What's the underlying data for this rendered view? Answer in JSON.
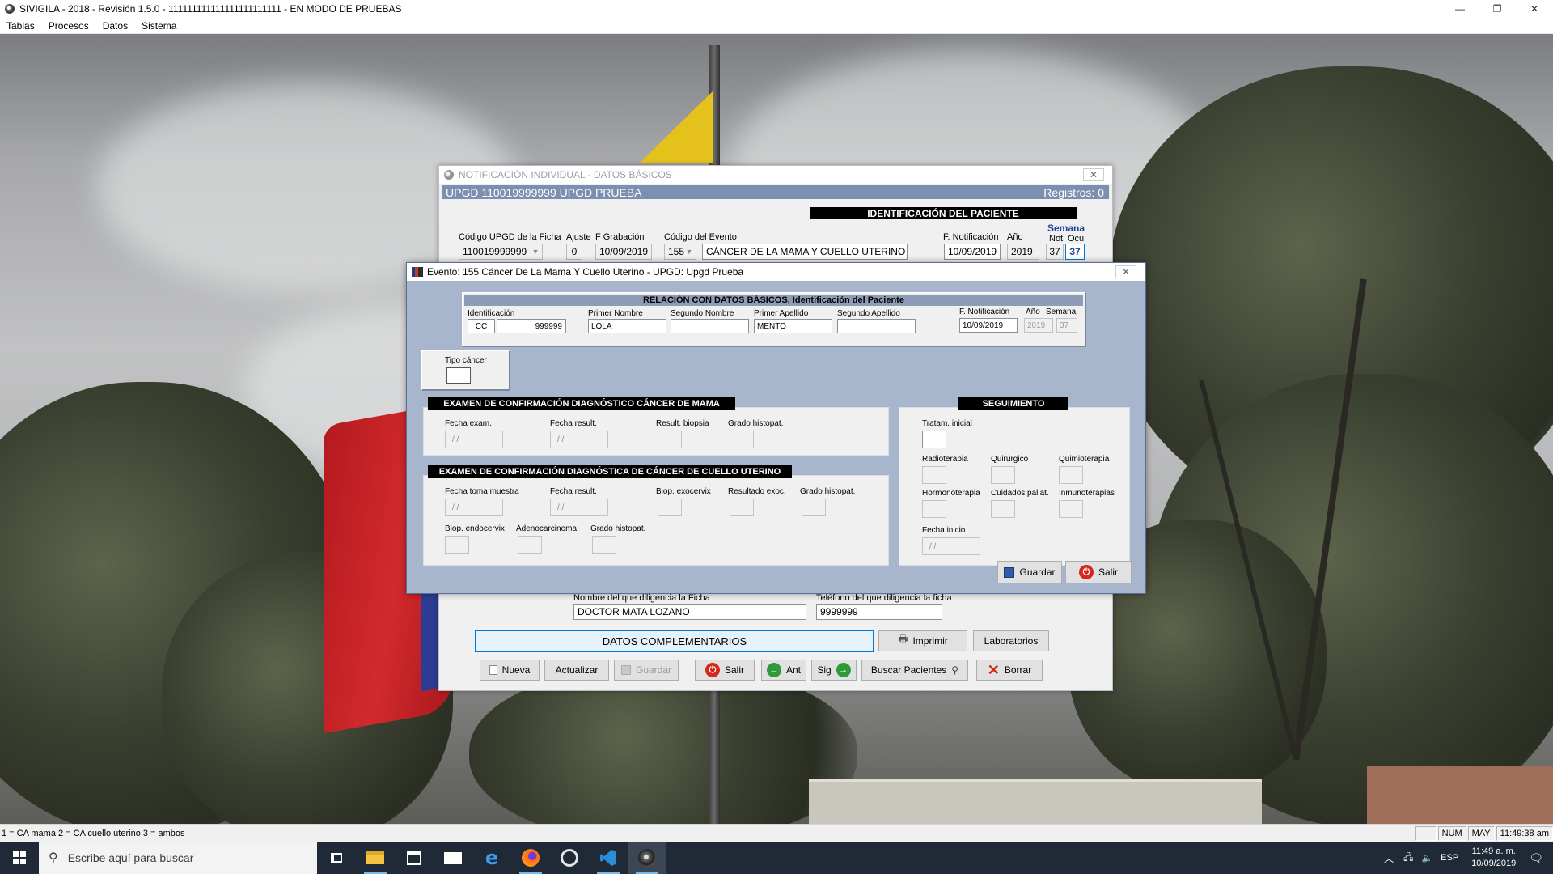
{
  "app": {
    "title": "SIVIGILA - 2018 - Revisión 1.5.0 - 111111111111111111111111 - EN MODO DE PRUEBAS",
    "window_controls": {
      "minimize": "—",
      "restore": "❐",
      "close": "✕"
    },
    "menu": [
      "Tablas",
      "Procesos",
      "Datos",
      "Sistema"
    ]
  },
  "back_dialog": {
    "title": "NOTIFICACIÓN INDIVIDUAL - DATOS BÁSICOS",
    "upgd_bar": "UPGD 110019999999 UPGD PRUEBA",
    "registros": "Registros: 0",
    "section_header": "IDENTIFICACIÓN DEL PACIENTE",
    "labels": {
      "codigo_upgd": "Código UPGD de la Ficha",
      "ajuste": "Ajuste",
      "f_grabacion": "F Grabación",
      "codigo_evento": "Código del Evento",
      "f_notificacion": "F. Notificación",
      "anio": "Año",
      "semana": "Semana",
      "not": "Not",
      "ocu": "Ocu",
      "nombre_diligencia": "Nombre del que diligencia la Ficha",
      "telefono_diligencia": "Teléfono del que diligencia la ficha"
    },
    "values": {
      "codigo_upgd": "110019999999",
      "ajuste": "0",
      "f_grabacion": "10/09/2019",
      "codigo_evento": "155",
      "evento_nombre": "CÁNCER DE LA MAMA Y CUELLO UTERINO",
      "f_notificacion": "10/09/2019",
      "anio": "2019",
      "semana_not": "37",
      "semana_ocu": "37",
      "nombre_diligencia": "DOCTOR MATA LOZANO",
      "telefono_diligencia": "9999999"
    },
    "buttons": {
      "datos_complementarios": "DATOS COMPLEMENTARIOS",
      "imprimir": "Imprimir",
      "laboratorios": "Laboratorios",
      "nueva": "Nueva",
      "actualizar": "Actualizar",
      "guardar": "Guardar",
      "salir": "Salir",
      "ant": "Ant",
      "sig": "Sig",
      "buscar_pacientes": "Buscar Pacientes",
      "borrar": "Borrar"
    }
  },
  "front_dialog": {
    "title": "Evento: 155  Cáncer De La Mama Y Cuello Uterino - UPGD: Upgd Prueba",
    "relacion_header": "RELACIÓN CON DATOS BÁSICOS,  Identificación del Paciente",
    "labels": {
      "identificacion": "Identificación",
      "primer_nombre": "Primer Nombre",
      "segundo_nombre": "Segundo Nombre",
      "primer_apellido": "Primer Apellido",
      "segundo_apellido": "Segundo Apellido",
      "f_notificacion": "F. Notificación",
      "anio": "Año",
      "semana": "Semana",
      "tipo_cancer": "Tipo cáncer"
    },
    "values": {
      "tipo_id": "CC",
      "numero_id": "999999",
      "primer_nombre": "LOLA",
      "segundo_nombre": "",
      "primer_apellido": "MENTO",
      "segundo_apellido": "",
      "f_notificacion": "10/09/2019",
      "anio": "2019",
      "semana": "37",
      "tipo_cancer": ""
    },
    "mama": {
      "title": "EXAMEN DE CONFIRMACIÓN DIAGNÓSTICO CÁNCER DE MAMA",
      "fecha_exam": "Fecha exam.",
      "fecha_result": "Fecha result.",
      "result_biopsia": "Result. biopsia",
      "grado_histopat": "Grado histopat.",
      "date_placeholder": "/  /"
    },
    "cuello": {
      "title": "EXAMEN DE CONFIRMACIÓN DIAGNÓSTICA DE CÁNCER DE CUELLO UTERINO",
      "fecha_toma_muestra": "Fecha toma muestra",
      "fecha_result": "Fecha result.",
      "biop_exocervix": "Biop. exocervix",
      "resultado_exoc": "Resultado exoc.",
      "grado_histopat_1": "Grado histopat.",
      "biop_endocervix": "Biop. endocervix",
      "adenocarcinoma": "Adenocarcinoma",
      "grado_histopat_2": "Grado histopat.",
      "date_placeholder": "/  /"
    },
    "seguimiento": {
      "title": "SEGUIMIENTO",
      "tratam_inicial": "Tratam. inicial",
      "radioterapia": "Radioterapia",
      "quirurgico": "Quirúrgico",
      "quimioterapia": "Quimioterapia",
      "hormonoterapia": "Hormonoterapia",
      "cuidados_paliat": "Cuidados paliat.",
      "inmunoterapias": "Inmunoterapias",
      "fecha_inicio": "Fecha inicio",
      "date_placeholder": "/  /"
    },
    "buttons": {
      "guardar": "Guardar",
      "salir": "Salir"
    }
  },
  "statusbar": {
    "text": "1 = CA mama 2 = CA cuello uterino 3 = ambos",
    "num": "NUM",
    "may": "MAY",
    "time": "11:49:38 am"
  },
  "taskbar": {
    "search_placeholder": "Escribe aquí para buscar",
    "lang": "ESP",
    "clock_time": "11:49 a. m.",
    "clock_date": "10/09/2019"
  },
  "colors": {
    "upgd_bar": "#7b8fb0",
    "front_dialog_bg": "#a7b6cc",
    "section_header": "#000000",
    "taskbar": "#1f2a36"
  }
}
